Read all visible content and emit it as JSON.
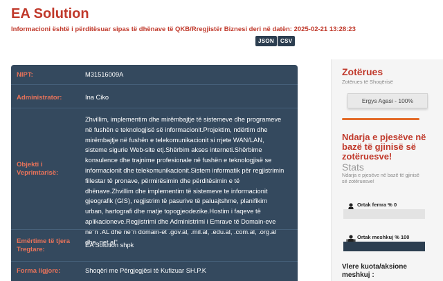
{
  "header": {
    "title": "EA Solution",
    "info": "Informacioni është i përditësuar sipas të dhënave të QKB/Rregjistër Biznesi deri në datën: 2025-02-21 13:28:23",
    "json_label": "JSON",
    "csv_label": "CSV"
  },
  "details": {
    "nipt_label": "NIPT:",
    "nipt_value": "M31516009A",
    "admin_label": "Administrator:",
    "admin_value": "Ina Ciko",
    "object_label": "Objekti i Veprimtarisë:",
    "object_value": "Zhvillim, implementim dhe mirëmbajtje të sistemeve dhe programeve në fushën e teknologjisë së informacionit.Projektim, ndërtim dhe mirëmbajtje në fushën e telekomunikacionit si rrjete WAN/LAN, sisteme sigurie Web-site etj.Shërbim akses interneti.Shërbime konsulence dhe trajnime profesionale në fushën e teknologjisë se informacionit dhe telekomunikacionit.Sistem informatik për regjistrimin fillestar të pronave, përmirësimin dhe përditësimin e të dhënave.Zhvillim dhe implementim të sistemeve te informacionit gjeografik (GIS), regjistrim të pasurive të paluajtshme, planifikim urban, hartografi dhe matje topogjeodezike.Hostim i faqeve të aplikacioneve.Regjistrimi dhe Administrimi i Emrave të Domain-eve ne¨n .AL dhe ne¨n domain-et .gov.al, .mil.al, .edu.al, .com.al, .org.al dhe .net.al\"",
    "trade_label": "Emërtime të tjera Tregtare:",
    "trade_value": "EA Solution shpk",
    "form_label": "Forma ligjore:",
    "form_value": "Shoqëri me Përgjegjësi të Kufizuar SH.P.K"
  },
  "sidebar": {
    "owners_title": "Zotërues",
    "owners_sub": "Zotërues të Shoqërisë",
    "owner_entry": "Ergys Agasi - 100%",
    "share_title": "Ndarja e pjesëve në bazë të gjinisë së zotëruesve!",
    "stats_title": "Stats",
    "stats_sub": "Ndarja e pjesëve në bazë të gjinisë së zotëruesve!",
    "female_label": "Ortak femra % 0",
    "female_pct": 0,
    "male_label": "Ortak meshkuj % 100",
    "male_pct": 100,
    "quota_title": "Vlere kuota/aksione meshkuj :"
  },
  "colors": {
    "accent": "#c0392b",
    "panel": "#34495e",
    "divider": "#e36c2a"
  }
}
